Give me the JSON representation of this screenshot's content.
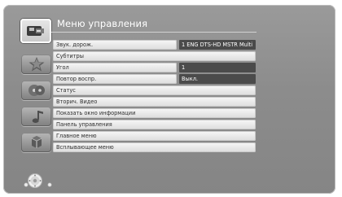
{
  "menu_title": "Меню управления",
  "icons": [
    {
      "name": "playback-control-icon",
      "active": true
    },
    {
      "name": "star-icon",
      "active": false
    },
    {
      "name": "disc-icon",
      "active": false
    },
    {
      "name": "music-icon",
      "active": false
    },
    {
      "name": "cube-icon",
      "active": false
    }
  ],
  "rows": [
    {
      "label": "Звук. дорож.",
      "value": "1 ENG DTS-HD MSTR Multi"
    },
    {
      "label": "Субтитры",
      "value": ""
    },
    {
      "label": "Угол",
      "value": "1"
    },
    {
      "label": "Повтор воспр.",
      "value": "Выкл."
    },
    {
      "label": "Статус"
    },
    {
      "label": "Вторич. Видео"
    },
    {
      "label": "Показать окно информации"
    },
    {
      "label": "Панель управления"
    },
    {
      "label": "Главное меню"
    },
    {
      "label": "Всплывающее меню"
    }
  ],
  "colors": {
    "background": "#8c8c8c",
    "value_bg": "#4b4b4b"
  }
}
